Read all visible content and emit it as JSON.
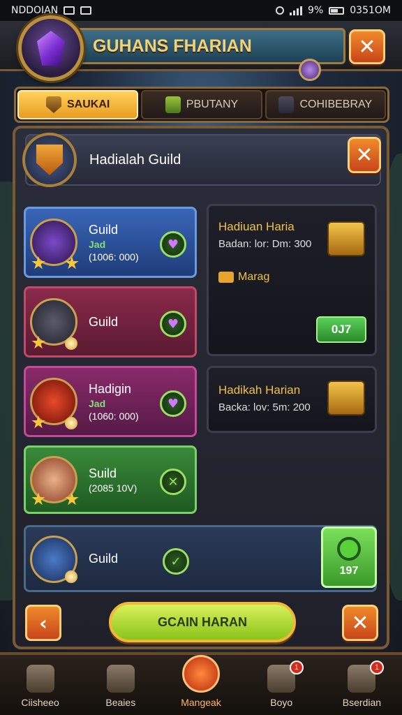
{
  "status_bar": {
    "carrier": "NDDOIAN",
    "battery": "9%",
    "time": "0351OM"
  },
  "header": {
    "title": "GUHANS FHARIAN"
  },
  "tabs": [
    {
      "label": "SAUKAI",
      "active": true
    },
    {
      "label": "PBUTANY",
      "active": false
    },
    {
      "label": "COHIBEBRAY",
      "active": false
    }
  ],
  "section": {
    "title": "Hadialah Guild"
  },
  "guild_cards": [
    {
      "name": "Guild",
      "sub": "Jad",
      "value": "(1006: 000)"
    },
    {
      "name": "Guild",
      "sub": "",
      "value": ""
    },
    {
      "name": "Hadigin",
      "sub": "Jad",
      "value": "(1060: 000)"
    },
    {
      "name": "Suild",
      "sub": "",
      "value": "(2085 10V)"
    },
    {
      "name": "Guild",
      "sub": "",
      "value": ""
    }
  ],
  "rewards": [
    {
      "title": "Hadiuan Haria",
      "desc": "Badan: lor: Dm: 300",
      "currency": "Marag",
      "button": "0J7"
    },
    {
      "title": "Hadikah Harian",
      "desc": "Backa: lov: 5m: 200"
    }
  ],
  "claim_button": {
    "label": "197"
  },
  "main_button": {
    "label": "GCAIN HARAN"
  },
  "bottom_nav": [
    {
      "label": "Ciisheeo",
      "icon": "house-icon",
      "badge": ""
    },
    {
      "label": "Beaies",
      "icon": "crystal-icon",
      "badge": ""
    },
    {
      "label": "Mangeak",
      "icon": "shield-icon",
      "badge": "",
      "active": true
    },
    {
      "label": "Boyo",
      "icon": "pet-icon",
      "badge": "1"
    },
    {
      "label": "Bserdian",
      "icon": "dice-icon",
      "badge": "1"
    }
  ]
}
